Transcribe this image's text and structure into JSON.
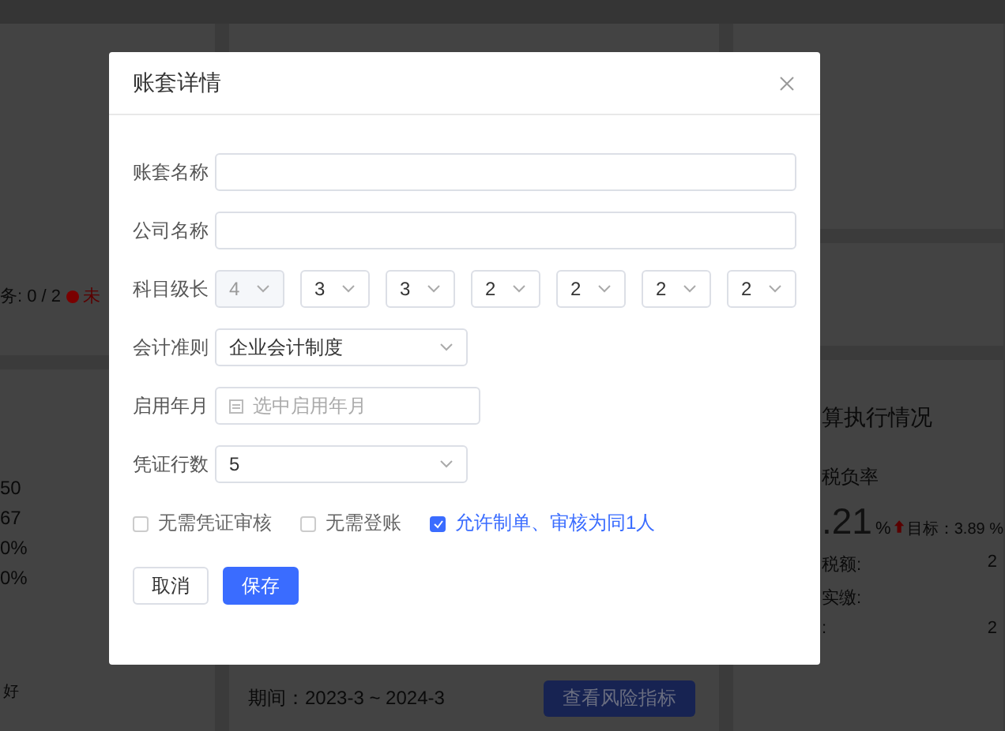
{
  "background": {
    "left": {
      "task": "务: 0 / 2",
      "task_status": "未",
      "values": [
        "50",
        "67",
        "0%",
        "0%"
      ],
      "footer": "好"
    },
    "middle": {
      "period": "期间：2023-3 ~ 2024-3",
      "button": "查看风险指标"
    },
    "right": {
      "title": "算执行情况",
      "metric": "税负率",
      "value": ".21",
      "unit": "%",
      "target": "目标：3.89 %",
      "rows": [
        {
          "label": "税额:",
          "value": "2"
        },
        {
          "label": "实缴:",
          "value": ""
        },
        {
          "label": ":",
          "value": "2"
        }
      ]
    }
  },
  "dialog": {
    "title": "账套详情",
    "fields": [
      {
        "kind": "text",
        "label": "账套名称"
      },
      {
        "kind": "text",
        "label": "公司名称"
      },
      {
        "kind": "levels",
        "label": "科目级长",
        "options": [
          {
            "value": "4",
            "disabled": true
          },
          {
            "value": "3",
            "disabled": false
          },
          {
            "value": "3",
            "disabled": false
          },
          {
            "value": "2",
            "disabled": false
          },
          {
            "value": "2",
            "disabled": false
          },
          {
            "value": "2",
            "disabled": false
          },
          {
            "value": "2",
            "disabled": false
          }
        ]
      },
      {
        "kind": "select",
        "label": "会计准则",
        "value": "企业会计制度"
      },
      {
        "kind": "date",
        "label": "启用年月",
        "placeholder": "选中启用年月"
      },
      {
        "kind": "select",
        "label": "凭证行数",
        "value": "5"
      }
    ],
    "checkboxes": [
      {
        "label": "无需凭证审核",
        "checked": false
      },
      {
        "label": "无需登账",
        "checked": false
      },
      {
        "label": "允许制单、审核为同1人",
        "checked": true
      }
    ],
    "buttons": [
      {
        "label": "取消",
        "kind": "secondary"
      },
      {
        "label": "保存",
        "kind": "primary"
      }
    ]
  }
}
